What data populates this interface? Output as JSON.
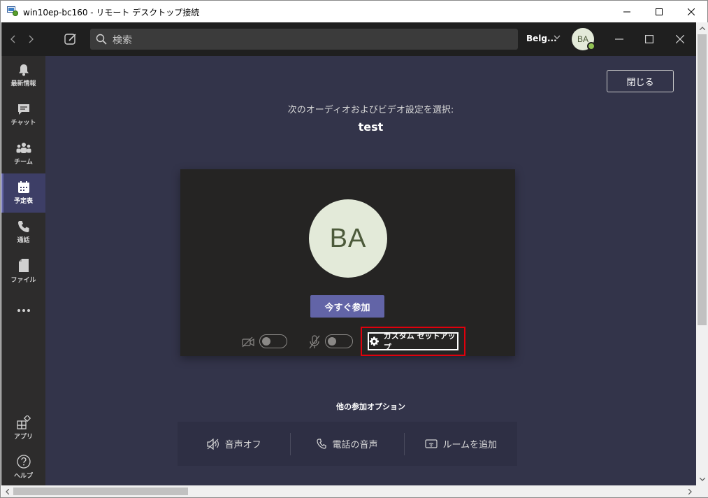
{
  "window": {
    "title": "win10ep-bc160 - リモート デスクトップ接続"
  },
  "topbar": {
    "search_placeholder": "検索",
    "org_name": "Belg...",
    "avatar_initials": "BA"
  },
  "rail": {
    "items": [
      {
        "label": "最新情報",
        "icon": "bell-icon"
      },
      {
        "label": "チャット",
        "icon": "chat-icon"
      },
      {
        "label": "チーム",
        "icon": "teams-icon"
      },
      {
        "label": "予定表",
        "icon": "calendar-icon",
        "active": true
      },
      {
        "label": "通話",
        "icon": "phone-icon"
      },
      {
        "label": "ファイル",
        "icon": "file-icon"
      },
      {
        "label": "",
        "icon": "more-icon"
      }
    ],
    "bottom": [
      {
        "label": "アプリ",
        "icon": "apps-icon"
      },
      {
        "label": "ヘルプ",
        "icon": "help-icon"
      }
    ]
  },
  "main": {
    "close_label": "閉じる",
    "prompt": "次のオーディオおよびビデオ設定を選択:",
    "meeting_title": "test",
    "preview": {
      "avatar_initials": "BA",
      "join_label": "今すぐ参加",
      "camera_on": false,
      "mic_on": false,
      "custom_setup_label": "カスタム セットアップ"
    },
    "other_options_title": "他の参加オプション",
    "other_options": [
      {
        "label": "音声オフ",
        "icon": "speaker-off-icon"
      },
      {
        "label": "電話の音声",
        "icon": "phone-icon"
      },
      {
        "label": "ルームを追加",
        "icon": "room-icon"
      }
    ]
  },
  "colors": {
    "accent": "#6264a7",
    "highlight": "#e0000c",
    "background": "#33344a",
    "rail": "#2d2c2c"
  }
}
